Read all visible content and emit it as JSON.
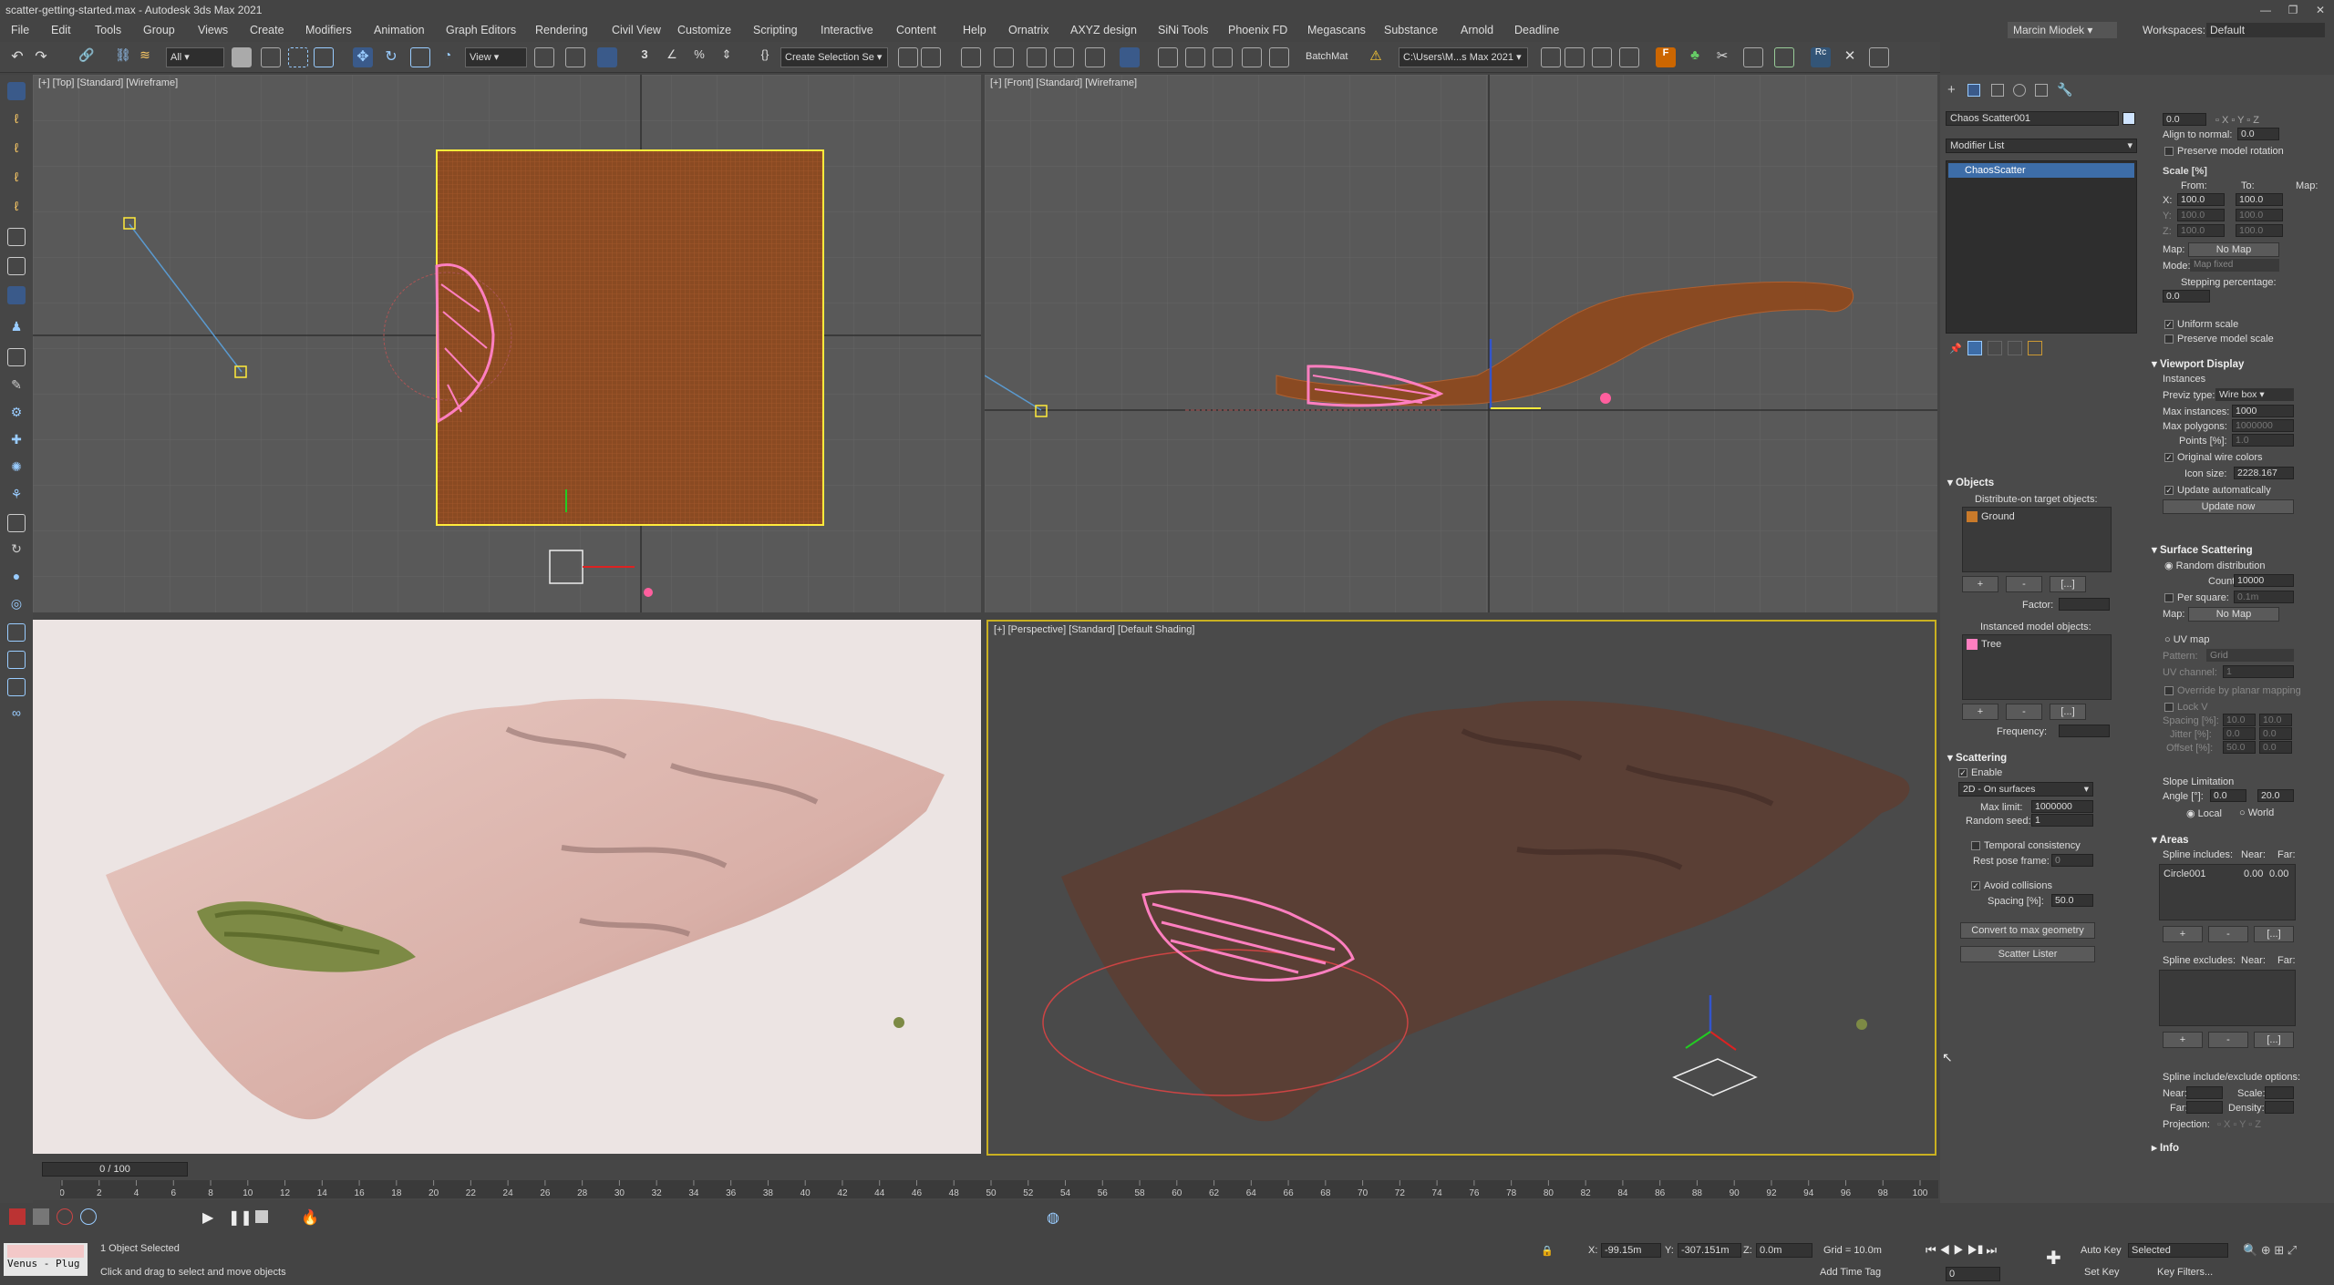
{
  "window": {
    "title": "scatter-getting-started.max - Autodesk 3ds Max 2021",
    "min": "—",
    "max": "❐",
    "close": "✕"
  },
  "menu": [
    "File",
    "Edit",
    "Tools",
    "Group",
    "Views",
    "Create",
    "Modifiers",
    "Animation",
    "Graph Editors",
    "Rendering",
    "Civil View",
    "Customize",
    "Scripting",
    "Interactive",
    "Content",
    "Help",
    "Ornatrix",
    "AXYZ design",
    "SiNi Tools",
    "Phoenix FD",
    "Megascans",
    "Substance",
    "Arnold",
    "Deadline"
  ],
  "user": "Marcin Miodek",
  "workspace": {
    "label": "Workspaces:",
    "value": "Default"
  },
  "toolbar": {
    "filter": "All",
    "refcoord": "View",
    "selset": "Create Selection Se",
    "batchmat": "BatchMat",
    "path": "C:\\Users\\M...s Max 2021"
  },
  "viewports": {
    "top": "[+] [Top] [Standard] [Wireframe]",
    "front": "[+] [Front] [Standard] [Wireframe]",
    "persp": "[+] [Perspective] [Standard] [Default Shading]"
  },
  "modifier": {
    "object_name": "Chaos Scatter001",
    "list_label": "Modifier List",
    "stack_item": "ChaosScatter"
  },
  "objects": {
    "header": "Objects",
    "distribute_label": "Distribute-on target objects:",
    "target": "Ground",
    "add": "+",
    "remove": "-",
    "more": "[...]",
    "factor_label": "Factor:",
    "instanced_label": "Instanced model objects:",
    "model": "Tree",
    "frequency_label": "Frequency:"
  },
  "scattering": {
    "header": "Scattering",
    "enable": "Enable",
    "mode": "2D - On surfaces",
    "max_limit_label": "Max limit:",
    "max_limit": "1000000",
    "seed_label": "Random seed:",
    "seed": "1",
    "temporal": "Temporal consistency",
    "rest_pose_label": "Rest pose frame:",
    "rest_pose": "0",
    "avoid": "Avoid collisions",
    "spacing_label": "Spacing [%]:",
    "spacing": "50.0",
    "convert": "Convert to max geometry",
    "lister": "Scatter Lister"
  },
  "right": {
    "rot_val": "0.0",
    "align_label": "Align to normal:",
    "align": "0.0",
    "preserve_rot": "Preserve model rotation",
    "scale_header": "Scale [%]",
    "from": "From:",
    "to": "To:",
    "map_col": "Map:",
    "x_from": "100.0",
    "x_to": "100.0",
    "y_from": "100.0",
    "y_to": "100.0",
    "z_from": "100.0",
    "z_to": "100.0",
    "map_label": "Map:",
    "no_map": "No Map",
    "mode_label": "Mode:",
    "mode": "Map fixed",
    "stepping": "Stepping percentage:",
    "stepping_val": "0.0",
    "uniform": "Uniform scale",
    "preserve_scale": "Preserve model scale",
    "vd_header": "Viewport Display",
    "instances": "Instances",
    "previz_label": "Previz type:",
    "previz": "Wire box",
    "max_inst_label": "Max instances:",
    "max_inst": "1000",
    "max_poly_label": "Max polygons:",
    "max_poly": "1000000",
    "points_label": "Points [%]:",
    "points": "1.0",
    "orig_wire": "Original wire colors",
    "icon_label": "Icon size:",
    "icon_size": "2228.167",
    "update_auto": "Update automatically",
    "update_now": "Update now",
    "ss_header": "Surface Scattering",
    "random": "Random distribution",
    "count_label": "Count:",
    "count": "10000",
    "per_square": "Per square:",
    "per_square_val": "0.1m",
    "uv_map": "UV map",
    "pattern_label": "Pattern:",
    "pattern": "Grid",
    "uv_channel_label": "UV channel:",
    "uv_channel": "1",
    "override": "Override by planar mapping",
    "lock": "Lock V",
    "spacing_label": "Spacing [%]:",
    "jitter_label": "Jitter [%]:",
    "offset_label": "Offset [%]:",
    "sp_u": "10.0",
    "sp_v": "10.0",
    "jit_u": "0.0",
    "jit_v": "0.0",
    "off_u": "50.0",
    "off_v": "0.0",
    "slope_header": "Slope Limitation",
    "angle_label": "Angle [°]:",
    "angle_min": "0.0",
    "angle_max": "20.0",
    "local": "Local",
    "world": "World",
    "areas_header": "Areas",
    "spline_inc": "Spline includes:",
    "near": "Near:",
    "far": "Far:",
    "circle": "Circle001",
    "circle_near": "0.00",
    "circle_far": "0.00",
    "spline_exc": "Spline excludes:",
    "options": "Spline include/exclude options:",
    "near2": "Near:",
    "scale2": "Scale:",
    "far2": "Far:",
    "density": "Density:",
    "projection": "Projection:",
    "info_header": "Info"
  },
  "timeline": {
    "frame": "0 / 100",
    "ticks": [
      "0",
      "2",
      "4",
      "6",
      "8",
      "10",
      "12",
      "14",
      "16",
      "18",
      "20",
      "22",
      "24",
      "26",
      "28",
      "30",
      "32",
      "34",
      "36",
      "38",
      "40",
      "42",
      "44",
      "46",
      "48",
      "50",
      "52",
      "54",
      "56",
      "58",
      "60",
      "62",
      "64",
      "66",
      "68",
      "70",
      "72",
      "74",
      "76",
      "78",
      "80",
      "82",
      "84",
      "86",
      "88",
      "90",
      "92",
      "94",
      "96",
      "98",
      "100"
    ]
  },
  "status": {
    "script": "Venus - Plug",
    "selected": "1 Object Selected",
    "hint": "Click and drag to select and move objects",
    "x": "-99.15m",
    "y": "-307.151m",
    "z": "0.0m",
    "grid": "Grid = 10.0m",
    "add_tag": "Add Time Tag",
    "autokey": "Auto Key",
    "selected_mode": "Selected",
    "setkey": "Set Key",
    "keyfilters": "Key Filters...",
    "frame_field": "0"
  }
}
